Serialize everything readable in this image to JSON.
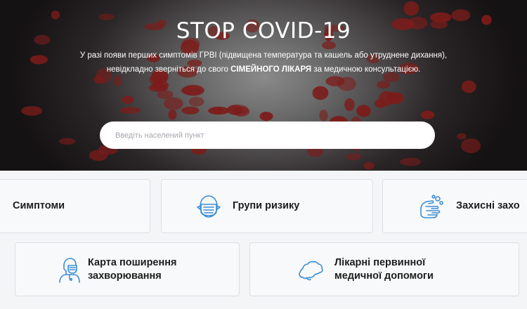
{
  "hero": {
    "title": "STOP COVID-19",
    "subtitle_part1": "У разі появи перших симптомів ГРВІ (підвищена температура та кашель або утруднене дихання), невідкладно зверніться до свого ",
    "subtitle_bold": "СІМЕЙНОГО ЛІКАРЯ",
    "subtitle_part2": " за медичною консультацією."
  },
  "search": {
    "placeholder": "Введіть населений пункт"
  },
  "cards": {
    "symptoms": {
      "label": "Симптоми",
      "icon": "thermometer-icon"
    },
    "risk_groups": {
      "label": "Групи ризику",
      "icon": "face-mask-icon"
    },
    "protection": {
      "label": "Захисні захо",
      "icon": "hand-washing-icon"
    },
    "spread_map": {
      "label_line1": "Карта поширення",
      "label_line2": "захворювання",
      "icon": "person-mask-icon"
    },
    "clinics": {
      "label_line1": "Лікарні первинної",
      "label_line2": "медичної допомоги",
      "icon": "ukraine-map-icon"
    }
  },
  "colors": {
    "icon_blue": "#3d8ed6",
    "hero_dark": "#151213",
    "virus_red": "#7c1c1a"
  }
}
